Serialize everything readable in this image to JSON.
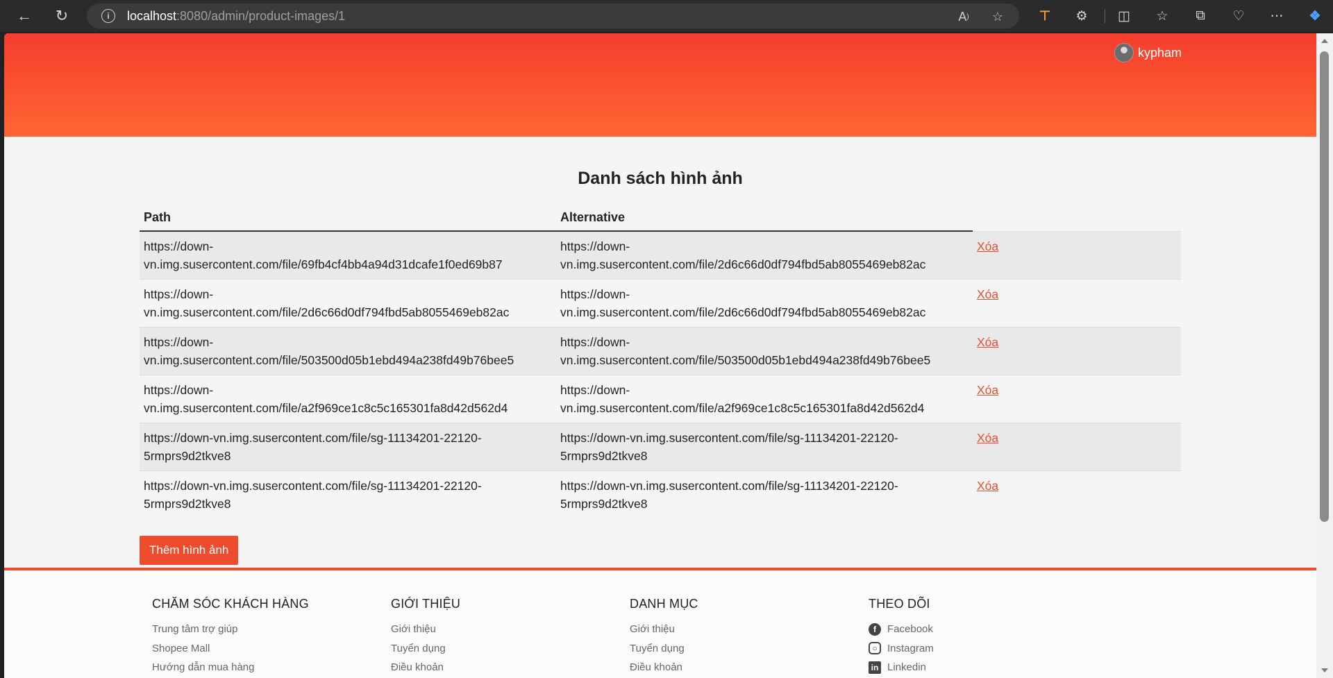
{
  "browser": {
    "url_host": "localhost",
    "url_path": ":8080/admin/product-images/1"
  },
  "header": {
    "username": "kypham"
  },
  "main": {
    "title": "Danh sách hình ảnh",
    "columns": [
      "Path",
      "Alternative"
    ],
    "rows": [
      {
        "path_1": "https://down-",
        "path_2": "vn.img.susercontent.com/file/69fb4cf4bb4a94d31dcafe1f0ed69b87",
        "alt_1": "https://down-",
        "alt_2": "vn.img.susercontent.com/file/2d6c66d0df794fbd5ab8055469eb82ac",
        "action": "Xóa"
      },
      {
        "path_1": "https://down-",
        "path_2": "vn.img.susercontent.com/file/2d6c66d0df794fbd5ab8055469eb82ac",
        "alt_1": "https://down-",
        "alt_2": "vn.img.susercontent.com/file/2d6c66d0df794fbd5ab8055469eb82ac",
        "action": "Xóa"
      },
      {
        "path_1": "https://down-",
        "path_2": "vn.img.susercontent.com/file/503500d05b1ebd494a238fd49b76bee5",
        "alt_1": "https://down-",
        "alt_2": "vn.img.susercontent.com/file/503500d05b1ebd494a238fd49b76bee5",
        "action": "Xóa"
      },
      {
        "path_1": "https://down-",
        "path_2": "vn.img.susercontent.com/file/a2f969ce1c8c5c165301fa8d42d562d4",
        "alt_1": "https://down-",
        "alt_2": "vn.img.susercontent.com/file/a2f969ce1c8c5c165301fa8d42d562d4",
        "action": "Xóa"
      },
      {
        "path_1": "https://down-vn.img.susercontent.com/file/sg-11134201-22120-",
        "path_2": "5rmprs9d2tkve8",
        "alt_1": "https://down-vn.img.susercontent.com/file/sg-11134201-22120-",
        "alt_2": "5rmprs9d2tkve8",
        "action": "Xóa"
      },
      {
        "path_1": "https://down-vn.img.susercontent.com/file/sg-11134201-22120-",
        "path_2": "5rmprs9d2tkve8",
        "alt_1": "https://down-vn.img.susercontent.com/file/sg-11134201-22120-",
        "alt_2": "5rmprs9d2tkve8",
        "action": "Xóa"
      }
    ],
    "add_button": "Thêm hình ảnh"
  },
  "footer": {
    "col1": {
      "title": "CHĂM SÓC KHÁCH HÀNG",
      "links": [
        "Trung tâm trợ giúp",
        "Shopee Mall",
        "Hướng dẫn mua hàng"
      ]
    },
    "col2": {
      "title": "GIỚI THIỆU",
      "links": [
        "Giới thiệu",
        "Tuyển dụng",
        "Điều khoản"
      ]
    },
    "col3": {
      "title": "DANH MỤC",
      "links": [
        "Giới thiệu",
        "Tuyển dụng",
        "Điều khoản"
      ]
    },
    "col4": {
      "title": "THEO DÕI",
      "links": [
        "Facebook",
        "Instagram",
        "Linkedin"
      ]
    }
  },
  "colors": {
    "brand": "#ee4d2d",
    "header_top": "#f53d2d",
    "header_bottom": "#ff6633"
  },
  "icons": [
    "back-arrow-icon",
    "refresh-icon",
    "info-icon",
    "read-aloud-icon",
    "favorite-star-icon",
    "extension-icon",
    "split-screen-icon",
    "favorites-icon",
    "collections-icon",
    "health-icon",
    "more-icon",
    "copilot-icon",
    "facebook-icon",
    "instagram-icon",
    "linkedin-icon"
  ]
}
